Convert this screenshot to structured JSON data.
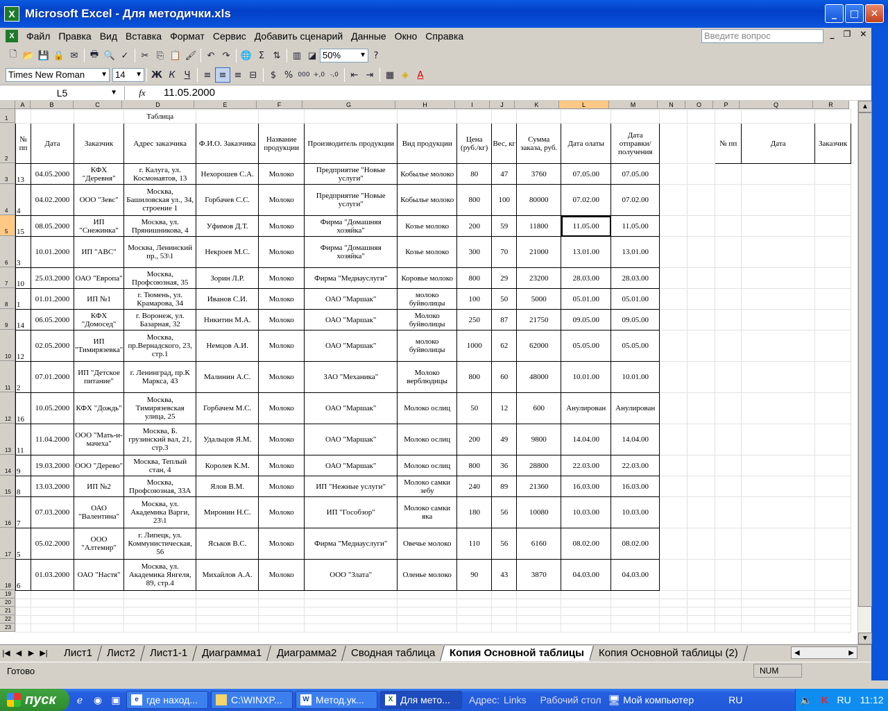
{
  "window": {
    "title": "Microsoft Excel - Для методички.xls",
    "app_icon": "X",
    "buttons": {
      "minimize": "_",
      "maximize": "□",
      "close": "✕"
    }
  },
  "menu": {
    "items": [
      "Файл",
      "Правка",
      "Вид",
      "Вставка",
      "Формат",
      "Сервис",
      "Добавить сценарий",
      "Данные",
      "Окно",
      "Справка"
    ],
    "ask_placeholder": "Введите вопрос"
  },
  "toolbar": {
    "zoom": "50%",
    "font_name": "Times New Roman",
    "font_size": "14"
  },
  "formula_bar": {
    "name_box": "L5",
    "fx": "fx",
    "value": "11.05.2000"
  },
  "columns": [
    "A",
    "B",
    "C",
    "D",
    "E",
    "F",
    "G",
    "H",
    "I",
    "J",
    "K",
    "L",
    "M",
    "N",
    "O",
    "P",
    "Q",
    "R"
  ],
  "selected_column": "L",
  "selected_row": "5",
  "row_numbers": [
    "1",
    "2",
    "3",
    "4",
    "5",
    "6",
    "7",
    "8",
    "9",
    "10",
    "11",
    "12",
    "13",
    "14",
    "15",
    "16",
    "17",
    "18",
    "19",
    "20",
    "21",
    "22",
    "23"
  ],
  "sheet": {
    "title": "Таблица",
    "headers": [
      "№ пп",
      "Дата",
      "Заказчик",
      "Адрес заказчика",
      "Ф.И.О. Заказчика",
      "Название продукции",
      "Производитель продукции",
      "Вид продукции",
      "Цена (руб./кг)",
      "Вес, кг",
      "Сумма заказа, руб.",
      "Дата олаты",
      "Дата отправки/получения"
    ],
    "side_headers": [
      "№ пп",
      "Дата",
      "Заказчик"
    ],
    "rows": [
      [
        "13",
        "04.05.2000",
        "КФХ \"Деревня\"",
        "г. Калуга, ул. Космонавтов, 13",
        "Нехорошев С.А.",
        "Молоко",
        "Предприятие \"Новые услуги\"",
        "Кобылье молоко",
        "80",
        "47",
        "3760",
        "07.05.00",
        "07.05.00"
      ],
      [
        "4",
        "04.02.2000",
        "ООО \"Зевс\"",
        "Москва, Башиловская ул., 34, строение 1",
        "Горбачев С.С.",
        "Молоко",
        "Предприятие \"Новые услуги\"",
        "Кобылье молоко",
        "800",
        "100",
        "80000",
        "07.02.00",
        "07.02.00"
      ],
      [
        "15",
        "08.05.2000",
        "ИП \"Снежинка\"",
        "Москва, ул. Прянишникова, 4",
        "Уфимов Д.Т.",
        "Молоко",
        "Фирма \"Домашняя хозяйка\"",
        "Козье молоко",
        "200",
        "59",
        "11800",
        "11.05.00",
        "11.05.00"
      ],
      [
        "3",
        "10.01.2000",
        "ИП \"АВС\"",
        "Москва, Ленинский пр., 53\\1",
        "Некроев М.С.",
        "Молоко",
        "Фирма \"Домашняя хозяйка\"",
        "Козье молоко",
        "300",
        "70",
        "21000",
        "13.01.00",
        "13.01.00"
      ],
      [
        "10",
        "25.03.2000",
        "ОАО \"Европа\"",
        "Москва, Профсоюзная, 35",
        "Зорин Л.Р.",
        "Молоко",
        "Фирма \"Медиауслуги\"",
        "Коровье молоко",
        "800",
        "29",
        "23200",
        "28.03.00",
        "28.03.00"
      ],
      [
        "1",
        "01.01.2000",
        "ИП №1",
        "г. Тюмень, ул. Крамарова, 34",
        "Иванов С.И.",
        "Молоко",
        "ОАО \"Маршак\"",
        "молоко буйволицы",
        "100",
        "50",
        "5000",
        "05.01.00",
        "05.01.00"
      ],
      [
        "14",
        "06.05.2000",
        "КФХ \"Домосед\"",
        "г. Воронеж, ул. Базарная, 32",
        "Никитин М.А.",
        "Молоко",
        "ОАО \"Маршак\"",
        "Молоко буйволицы",
        "250",
        "87",
        "21750",
        "09.05.00",
        "09.05.00"
      ],
      [
        "12",
        "02.05.2000",
        "ИП \"Тимирязевка\"",
        "Москва, пр.Вернадского, 23, стр.1",
        "Немцов А.И.",
        "Молоко",
        "ОАО \"Маршак\"",
        "молоко буйволицы",
        "1000",
        "62",
        "62000",
        "05.05.00",
        "05.05.00"
      ],
      [
        "2",
        "07.01.2000",
        "ИП \"Детское питание\"",
        "г. Ленинград, пр.К Маркса, 43",
        "Малинин А.С.",
        "Молоко",
        "ЗАО \"Механика\"",
        "Молоко верблюдицы",
        "800",
        "60",
        "48000",
        "10.01.00",
        "10.01.00"
      ],
      [
        "16",
        "10.05.2000",
        "КФХ \"Дождь\"",
        "Москва, Тимирязевская улица, 25",
        "Горбачем М.С.",
        "Молоко",
        "ОАО \"Маршак\"",
        "Молоко ослиц",
        "50",
        "12",
        "600",
        "Анулирован",
        "Анулирован"
      ],
      [
        "11",
        "11.04.2000",
        "ООО \"Мать-и-мачеха\"",
        "Москва, Б. грузинский вал, 21, стр.3",
        "Удальцов Я.М.",
        "Молоко",
        "ОАО \"Маршак\"",
        "Молоко ослиц",
        "200",
        "49",
        "9800",
        "14.04.00",
        "14.04.00"
      ],
      [
        "9",
        "19.03.2000",
        "ООО \"Дерево\"",
        "Москва, Теплый стан, 4",
        "Королев К.М.",
        "Молоко",
        "ОАО \"Маршак\"",
        "Молоко ослиц",
        "800",
        "36",
        "28800",
        "22.03.00",
        "22.03.00"
      ],
      [
        "8",
        "13.03.2000",
        "ИП №2",
        "Москва, Профсоюзная, 33А",
        "Ялов В.М.",
        "Молоко",
        "ИП \"Нежные услуги\"",
        "Молоко самки зебу",
        "240",
        "89",
        "21360",
        "16.03.00",
        "16.03.00"
      ],
      [
        "7",
        "07.03.2000",
        "ОАО \"Валентина\"",
        "Москва, ул. Академика Варги, 23\\1",
        "Миронин Н.С.",
        "Молоко",
        "ИП \"Гособзор\"",
        "Молоко самки яка",
        "180",
        "56",
        "10080",
        "10.03.00",
        "10.03.00"
      ],
      [
        "5",
        "05.02.2000",
        "ООО \"Алтемир\"",
        "г. Липецк, ул. Коммунистическая, 56",
        "Яськов В.С.",
        "Молоко",
        "Фирма \"Медиауслуги\"",
        "Овечье молоко",
        "110",
        "56",
        "6160",
        "08.02.00",
        "08.02.00"
      ],
      [
        "6",
        "01.03.2000",
        "ОАО \"Настя\"",
        "Москва, ул. Академика Янгеля, 89, стр.4",
        "Михайлов А.А.",
        "Молоко",
        "ООО \"Злата\"",
        "Оленье молоко",
        "90",
        "43",
        "3870",
        "04.03.00",
        "04.03.00"
      ]
    ]
  },
  "tabs": [
    "Лист1",
    "Лист2",
    "Лист1-1",
    "Диаграмма1",
    "Диаграмма2",
    "Сводная таблица",
    "Копия Основной таблицы",
    "Копия Основной таблицы (2)"
  ],
  "active_tab": "Копия Основной таблицы",
  "status": {
    "text": "Готово",
    "num": "NUM"
  },
  "taskbar": {
    "start": "пуск",
    "tasks": [
      "где наход...",
      "C:\\WINXP...",
      "Метод.ук...",
      "Для мето..."
    ],
    "address_label": "Адрес:",
    "links": "Links",
    "desktop": "Рабочий стол",
    "mycomputer": "Мой компьютер",
    "lang": "RU",
    "tray_lang": "RU",
    "clock": "11:12"
  }
}
